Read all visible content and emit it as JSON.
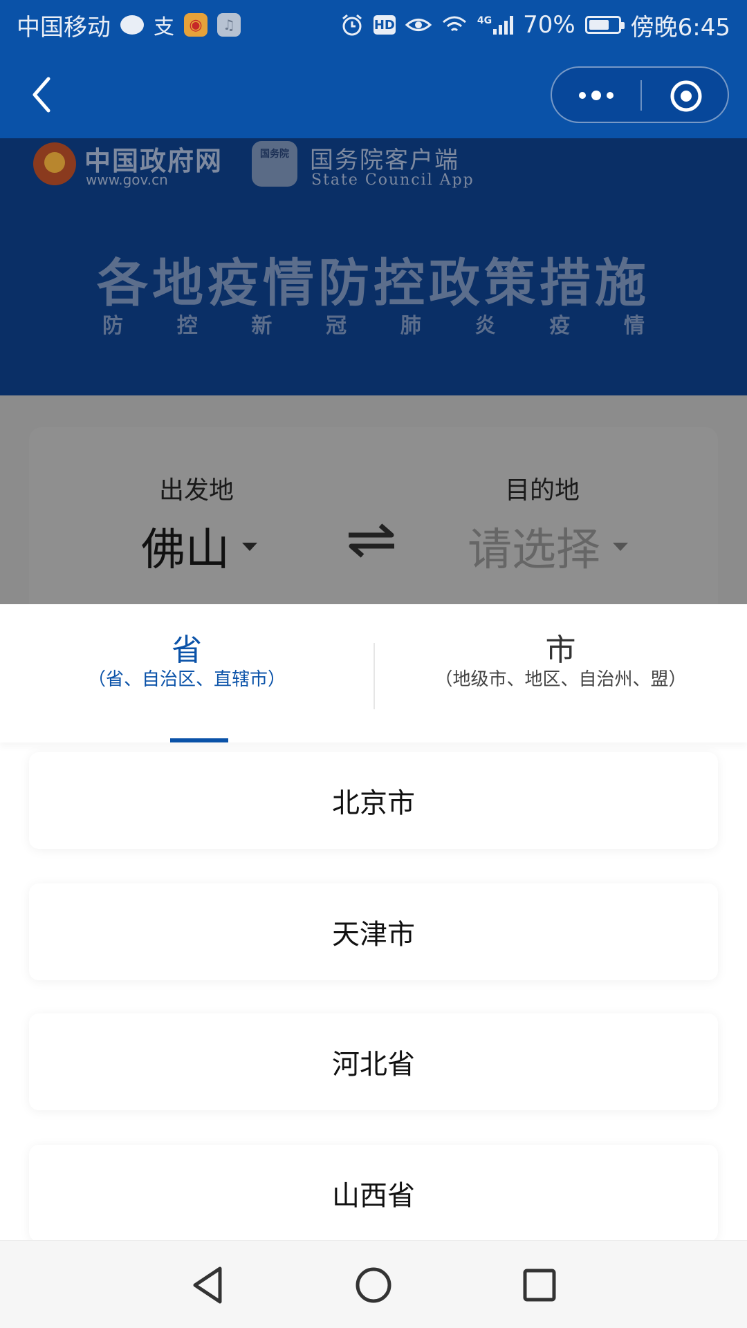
{
  "status_bar": {
    "carrier": "中国移动",
    "network": "4G",
    "battery": "70%",
    "battery_level": 0.7,
    "time": "傍晚6:45",
    "hd": "HD",
    "alipay": "支"
  },
  "banner": {
    "gov_name": "中国政府网",
    "gov_url": "www.gov.cn",
    "council_logo_text": "国务院",
    "council_name": "国务院客户端",
    "council_en": "State Council App",
    "title": "各地疫情防控政策措施",
    "subtitle_chars": [
      "防",
      "控",
      "新",
      "冠",
      "肺",
      "炎",
      "疫",
      "情"
    ]
  },
  "route": {
    "origin_label": "出发地",
    "origin_value": "佛山",
    "destination_label": "目的地",
    "destination_placeholder": "请选择"
  },
  "tabs": {
    "province_title": "省",
    "province_sub": "（省、自治区、直辖市）",
    "city_title": "市",
    "city_sub": "（地级市、地区、自治州、盟）"
  },
  "regions": [
    "北京市",
    "天津市",
    "河北省",
    "山西省"
  ],
  "colors": {
    "brand_blue": "#0a52a8",
    "banner_dark": "#0a2f66"
  }
}
